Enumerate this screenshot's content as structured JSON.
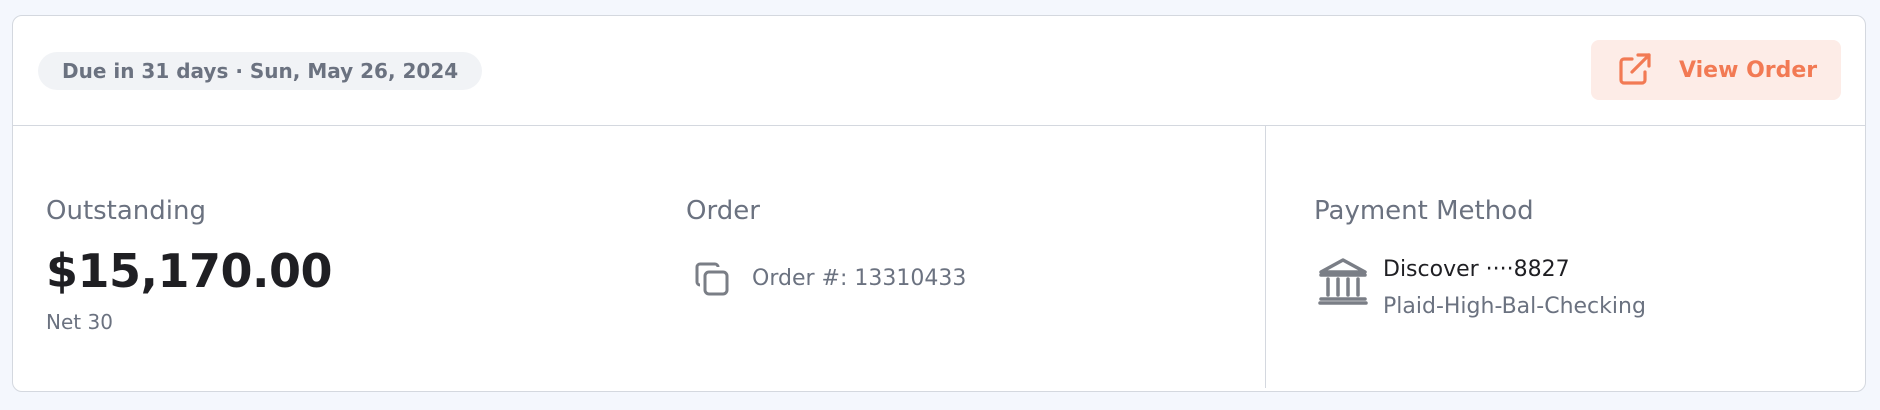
{
  "header": {
    "due_text": "Due in 31 days · Sun, May 26, 2024",
    "view_order_label": "View Order"
  },
  "outstanding": {
    "title": "Outstanding",
    "amount": "$15,170.00",
    "terms": "Net 30"
  },
  "order": {
    "title": "Order",
    "number_text": "Order #: 13310433"
  },
  "payment_method": {
    "title": "Payment Method",
    "account": "Discover ····8827",
    "account_name": "Plaid-High-Bal-Checking"
  },
  "colors": {
    "accent": "#f27a54",
    "accent_bg": "#fdece7",
    "muted_text": "#6b7280",
    "dark_text": "#1f1f23",
    "border": "#d4d8df"
  },
  "icons": {
    "view_order": "external-link-icon",
    "copy": "copy-icon",
    "bank": "bank-icon"
  }
}
